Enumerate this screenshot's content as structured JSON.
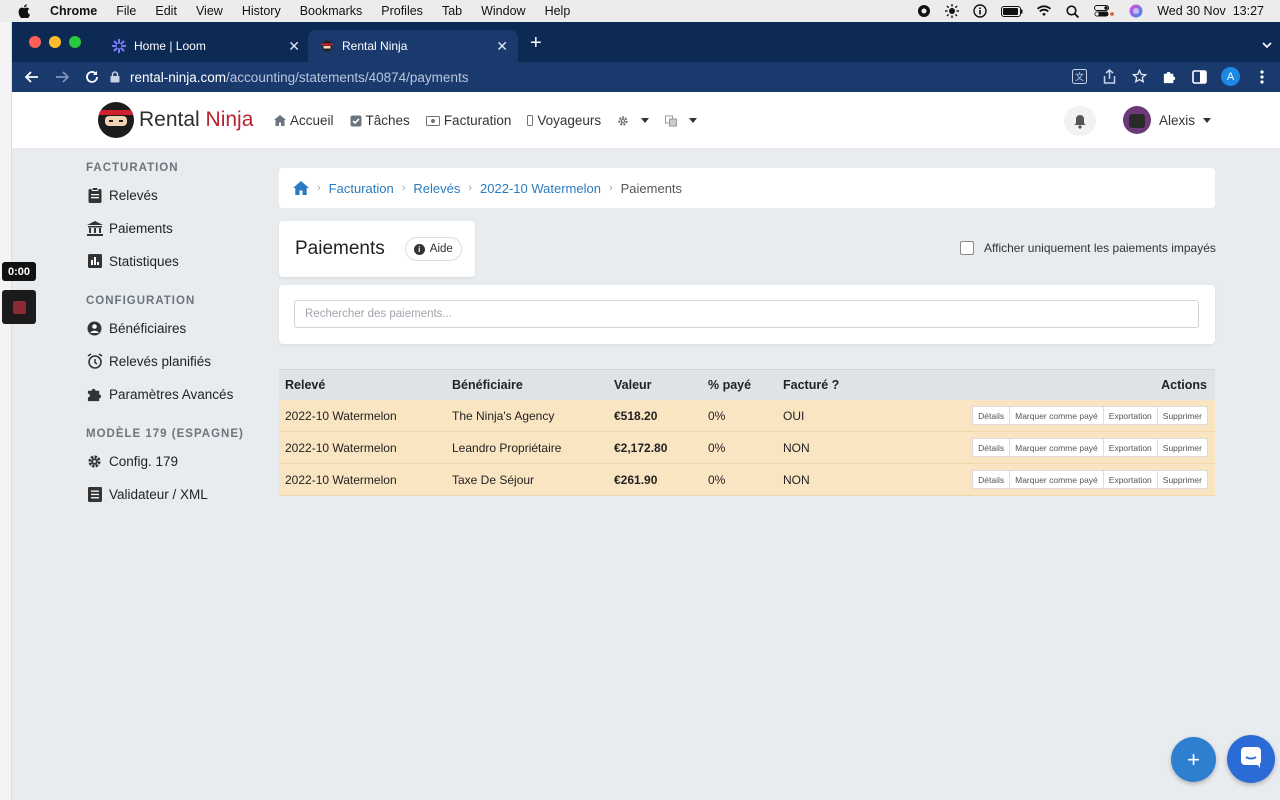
{
  "macos": {
    "menu": [
      "Chrome",
      "File",
      "Edit",
      "View",
      "History",
      "Bookmarks",
      "Profiles",
      "Tab",
      "Window",
      "Help"
    ],
    "clock": "Wed 30 Nov  13:27"
  },
  "loom": {
    "timer": "0:00"
  },
  "browser": {
    "tabs": [
      {
        "title": "Home | Loom"
      },
      {
        "title": "Rental Ninja"
      }
    ],
    "url_host": "rental-ninja.com",
    "url_path": "/accounting/statements/40874/payments",
    "profile_initial": "A"
  },
  "app": {
    "logo_rental": "Rental",
    "logo_ninja": "Ninja",
    "menu": {
      "accueil": "Accueil",
      "taches": "Tâches",
      "facturation": "Facturation",
      "voyageurs": "Voyageurs"
    },
    "user_name": "Alexis"
  },
  "sidebar": {
    "sections": [
      {
        "title": "FACTURATION",
        "items": [
          "Relevés",
          "Paiements",
          "Statistiques"
        ]
      },
      {
        "title": "CONFIGURATION",
        "items": [
          "Bénéficiaires",
          "Relevés planifiés",
          "Paramètres Avancés"
        ]
      },
      {
        "title": "MODÈLE 179 (ESPAGNE)",
        "items": [
          "Config. 179",
          "Validateur / XML"
        ]
      }
    ]
  },
  "breadcrumb": [
    "Facturation",
    "Relevés",
    "2022-10 Watermelon",
    "Paiements"
  ],
  "page": {
    "title": "Paiements",
    "help_label": "Aide",
    "filter_label": "Afficher uniquement les paiements impayés",
    "search_placeholder": "Rechercher des paiements..."
  },
  "table": {
    "headers": [
      "Relevé",
      "Bénéficiaire",
      "Valeur",
      "% payé",
      "Facturé ?",
      "Actions"
    ],
    "rows": [
      [
        "2022-10 Watermelon",
        "The Ninja's Agency",
        "€518.20",
        "0%",
        "OUI"
      ],
      [
        "2022-10 Watermelon",
        "Leandro Propriétaire",
        "€2,172.80",
        "0%",
        "NON"
      ],
      [
        "2022-10 Watermelon",
        "Taxe De Séjour",
        "€261.90",
        "0%",
        "NON"
      ]
    ],
    "actions": [
      "Détails",
      "Marquer comme payé",
      "Exportation",
      "Supprimer"
    ]
  },
  "fab": {
    "plus": "+"
  },
  "colors": {
    "tabstrip": "#0d2a55",
    "addressbar": "#1a3a6e",
    "row_unpaid": "#fae5c3",
    "link": "#2a7bc0",
    "brand_red": "#b8222e"
  }
}
